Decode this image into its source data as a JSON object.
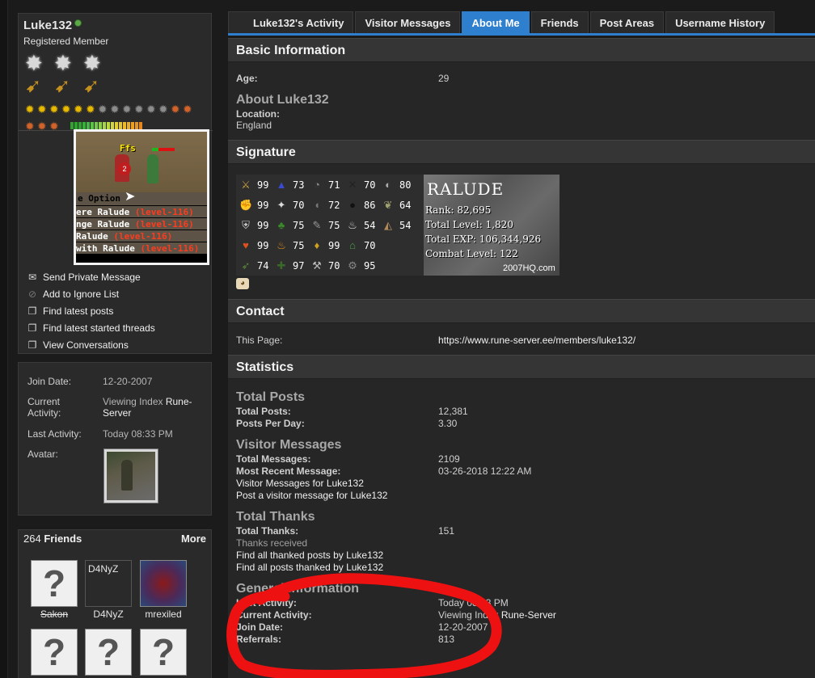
{
  "profile": {
    "username": "Luke132",
    "user_title": "Registered Member"
  },
  "game_image": {
    "overhead_text": "Ffs",
    "hitsplat": "2",
    "menu_title": "e Option",
    "menu_lines": [
      {
        "prefix": "ere Ralude ",
        "level": "(level-116)"
      },
      {
        "prefix": "nge Ralude ",
        "level": "(level-116)"
      },
      {
        "prefix": " Ralude ",
        "level": "(level-116)"
      },
      {
        "prefix": "with Ralude ",
        "level": "(level-116)"
      }
    ]
  },
  "actions": [
    {
      "icon": "envelope-icon",
      "label": "Send Private Message"
    },
    {
      "icon": "ignore-icon",
      "label": "Add to Ignore List"
    },
    {
      "icon": "posts-icon",
      "label": "Find latest posts"
    },
    {
      "icon": "threads-icon",
      "label": "Find latest started threads"
    },
    {
      "icon": "conversations-icon",
      "label": "View Conversations"
    }
  ],
  "sidebar_info": {
    "join_date_label": "Join Date:",
    "join_date": "12-20-2007",
    "current_activity_label": "Current Activity:",
    "current_activity_prefix": "Viewing Index",
    "current_activity_link": "Rune-Server",
    "last_activity_label": "Last Activity:",
    "last_activity": "Today 08:33 PM",
    "avatar_label": "Avatar:"
  },
  "friends_box": {
    "count": "264",
    "title": "Friends",
    "more": "More",
    "friends": [
      {
        "name": "Sakon",
        "avatar": "placeholder"
      },
      {
        "name": "D4NyZ",
        "avatar": "broken",
        "alt": "D4NyZ"
      },
      {
        "name": "mrexiled",
        "avatar": "red"
      },
      {
        "name": "",
        "avatar": "placeholder"
      },
      {
        "name": "",
        "avatar": "placeholder"
      },
      {
        "name": "",
        "avatar": "placeholder"
      }
    ]
  },
  "tabs": [
    {
      "label": "Luke132's Activity",
      "active": false
    },
    {
      "label": "Visitor Messages",
      "active": false
    },
    {
      "label": "About Me",
      "active": true
    },
    {
      "label": "Friends",
      "active": false
    },
    {
      "label": "Post Areas",
      "active": false
    },
    {
      "label": "Username History",
      "active": false
    }
  ],
  "basic_info": {
    "heading": "Basic Information",
    "age_label": "Age:",
    "age": "29",
    "about_heading": "About Luke132",
    "location_label": "Location:",
    "location": "England"
  },
  "signature": {
    "heading": "Signature",
    "skills": [
      [
        "99",
        "73",
        "71",
        "70",
        "80"
      ],
      [
        "99",
        "70",
        "72",
        "86",
        "64"
      ],
      [
        "99",
        "75",
        "75",
        "54",
        "54"
      ],
      [
        "99",
        "75",
        "99",
        "70",
        ""
      ],
      [
        "74",
        "97",
        "70",
        "95",
        ""
      ]
    ],
    "player_name": "RALUDE",
    "rank_label": "Rank:",
    "rank": "82,695",
    "total_level_label": "Total Level:",
    "total_level": "1,820",
    "total_exp_label": "Total EXP:",
    "total_exp": "106,344,926",
    "combat_label": "Combat Level:",
    "combat": "122",
    "brand": "2007HQ.com"
  },
  "contact": {
    "heading": "Contact",
    "page_label": "This Page:",
    "page_url": "https://www.rune-server.ee/members/luke132/"
  },
  "statistics": {
    "heading": "Statistics",
    "total_posts_heading": "Total Posts",
    "total_posts_label": "Total Posts:",
    "total_posts": "12,381",
    "posts_per_day_label": "Posts Per Day:",
    "posts_per_day": "3.30",
    "visitor_heading": "Visitor Messages",
    "total_messages_label": "Total Messages:",
    "total_messages": "2109",
    "recent_message_label": "Most Recent Message:",
    "recent_message": "03-26-2018 12:22 AM",
    "visitor_link": "Visitor Messages for Luke132",
    "post_visitor_link": "Post a visitor message for Luke132",
    "thanks_heading": "Total Thanks",
    "total_thanks_label": "Total Thanks:",
    "total_thanks": "151",
    "thanks_received": "Thanks received",
    "thanked_posts_link": "Find all thanked posts by Luke132",
    "posts_thanked_link": "Find all posts thanked by Luke132",
    "general_heading": "General Information",
    "last_activity_label": "Last Activity:",
    "last_activity": "Today 08:33 PM",
    "current_activity_label": "Current Activity:",
    "current_activity_prefix": "Viewing Index",
    "current_activity_link": "Rune-Server",
    "join_date_label": "Join Date:",
    "join_date": "12-20-2007",
    "referrals_label": "Referrals:",
    "referrals": "813"
  },
  "colors": {
    "accent": "#2f7fcf",
    "annotation": "#ee1111"
  }
}
